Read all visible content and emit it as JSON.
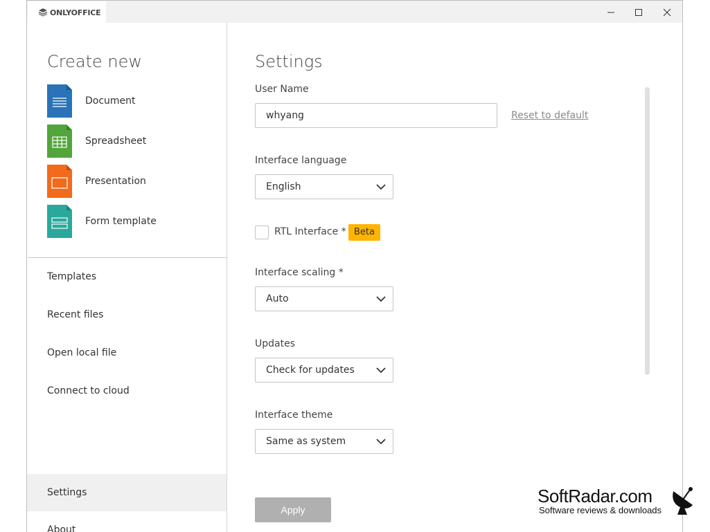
{
  "app": {
    "brand": "ONLYOFFICE"
  },
  "window_controls": {
    "minimize_icon": "minimize-icon",
    "maximize_icon": "maximize-icon",
    "close_icon": "close-icon"
  },
  "sidebar": {
    "create_title": "Create new",
    "create_items": [
      {
        "label": "Document",
        "icon": "document-icon",
        "color": "#2a73b8"
      },
      {
        "label": "Spreadsheet",
        "icon": "spreadsheet-icon",
        "color": "#52a53a"
      },
      {
        "label": "Presentation",
        "icon": "presentation-icon",
        "color": "#f26a1c"
      },
      {
        "label": "Form template",
        "icon": "form-template-icon",
        "color": "#2aa89b"
      }
    ],
    "nav_items": [
      {
        "label": "Templates"
      },
      {
        "label": "Recent files"
      },
      {
        "label": "Open local file"
      },
      {
        "label": "Connect to cloud"
      },
      {
        "label": "Settings",
        "active": true
      },
      {
        "label": "About"
      }
    ]
  },
  "settings": {
    "title": "Settings",
    "user_name_label": "User Name",
    "user_name_value": "whyang",
    "reset_link": "Reset to default",
    "language_label": "Interface language",
    "language_value": "English",
    "rtl_label": "RTL Interface *",
    "rtl_checked": false,
    "beta_badge": "Beta",
    "scaling_label": "Interface scaling *",
    "scaling_value": "Auto",
    "updates_label": "Updates",
    "updates_value": "Check for updates",
    "theme_label": "Interface theme",
    "theme_value": "Same as system",
    "apply_button": "Apply",
    "colors": {
      "beta": "#ffb400",
      "apply_disabled": "#b0b0b0"
    }
  },
  "watermark": {
    "title": "SoftRadar.com",
    "subtitle": "Software reviews & downloads"
  }
}
